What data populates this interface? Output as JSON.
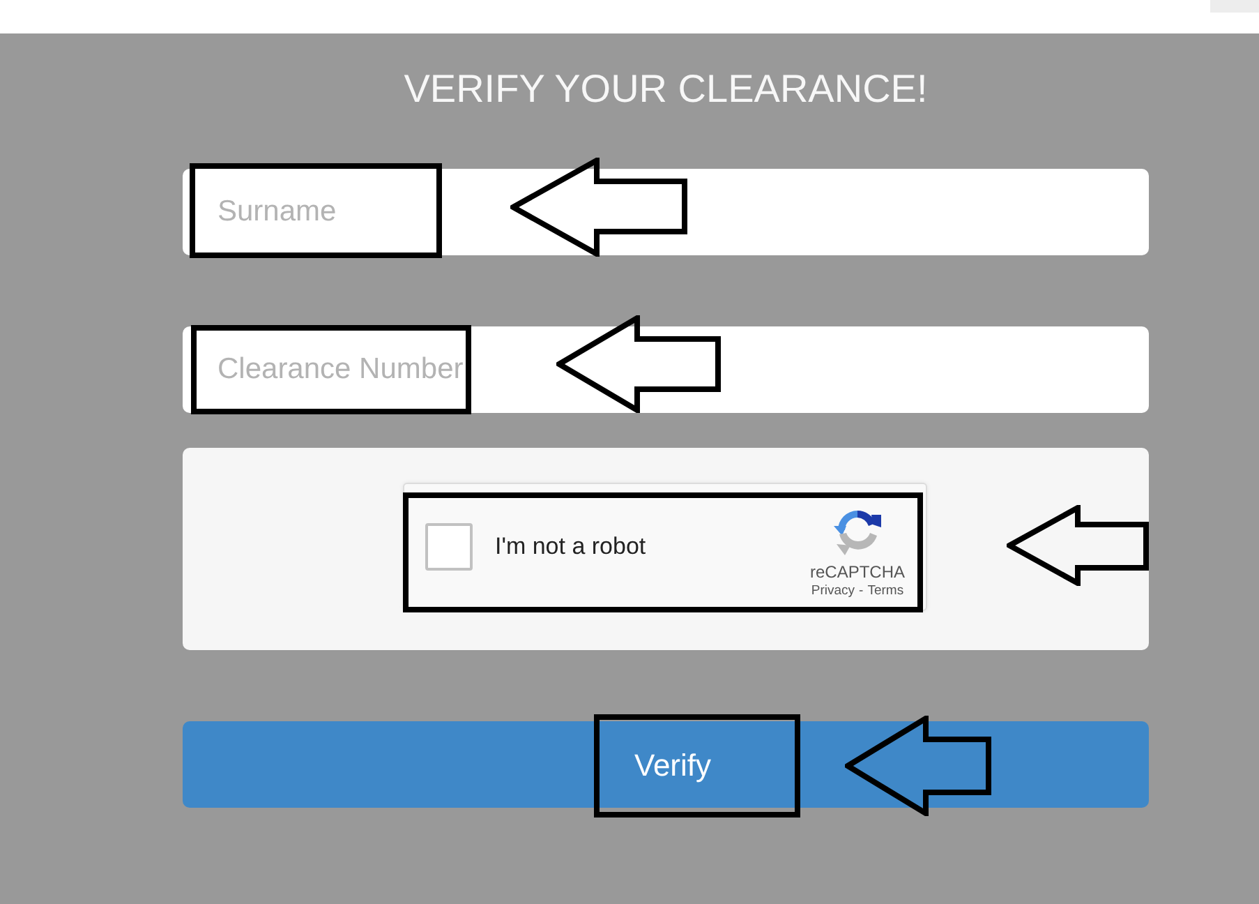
{
  "page": {
    "title": "VERIFY YOUR CLEARANCE!"
  },
  "fields": [
    {
      "placeholder": "Surname",
      "highlighted": true
    },
    {
      "placeholder": "Clearance Number",
      "highlighted": true
    }
  ],
  "captcha": {
    "label": "I'm not a robot",
    "checked": false,
    "brand": "reCAPTCHA",
    "links": [
      "Privacy",
      "Terms"
    ],
    "separator": "-",
    "highlighted": true
  },
  "submit": {
    "label": "Verify",
    "highlighted": true
  }
}
